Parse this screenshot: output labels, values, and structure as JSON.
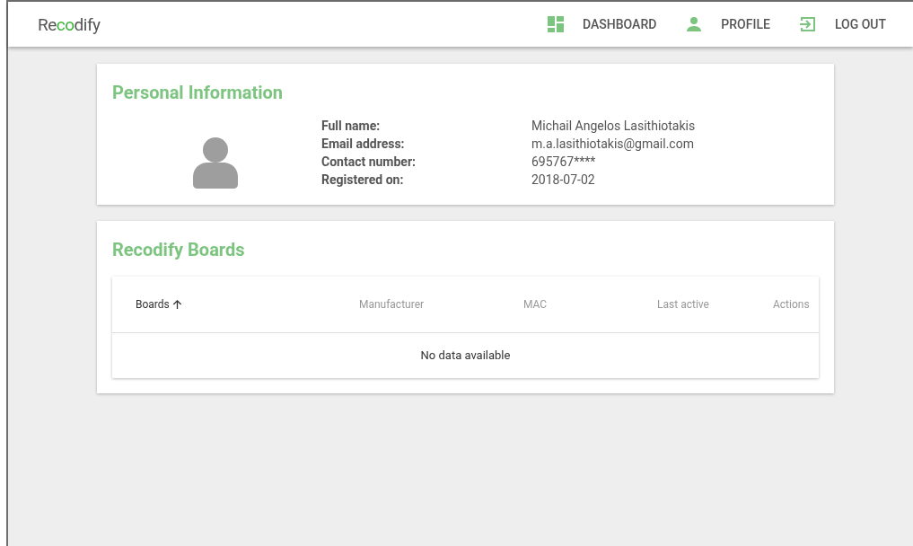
{
  "logo": {
    "start": "Re",
    "accent": "co",
    "end": "dify"
  },
  "nav": [
    {
      "label": "DASHBOARD",
      "kind": "dashboard"
    },
    {
      "label": "PROFILE",
      "kind": "profile"
    },
    {
      "label": "LOG OUT",
      "kind": "logout"
    }
  ],
  "personal_information": {
    "title": "Personal Information",
    "fields": [
      {
        "label": "Full name:",
        "value": "Michail Angelos Lasithiotakis"
      },
      {
        "label": "Email address:",
        "value": "m.a.lasithiotakis@gmail.com"
      },
      {
        "label": "Contact number:",
        "value": "695767****"
      },
      {
        "label": "Registered on:",
        "value": "2018-07-02"
      }
    ]
  },
  "boards": {
    "title": "Recodify Boards",
    "table": {
      "columns": [
        {
          "label": "Boards",
          "sorted": true
        },
        {
          "label": "Manufacturer",
          "sorted": false
        },
        {
          "label": "MAC",
          "sorted": false
        },
        {
          "label": "Last active",
          "sorted": false
        },
        {
          "label": "Actions",
          "sorted": false
        }
      ],
      "empty_message": "No data available"
    }
  }
}
